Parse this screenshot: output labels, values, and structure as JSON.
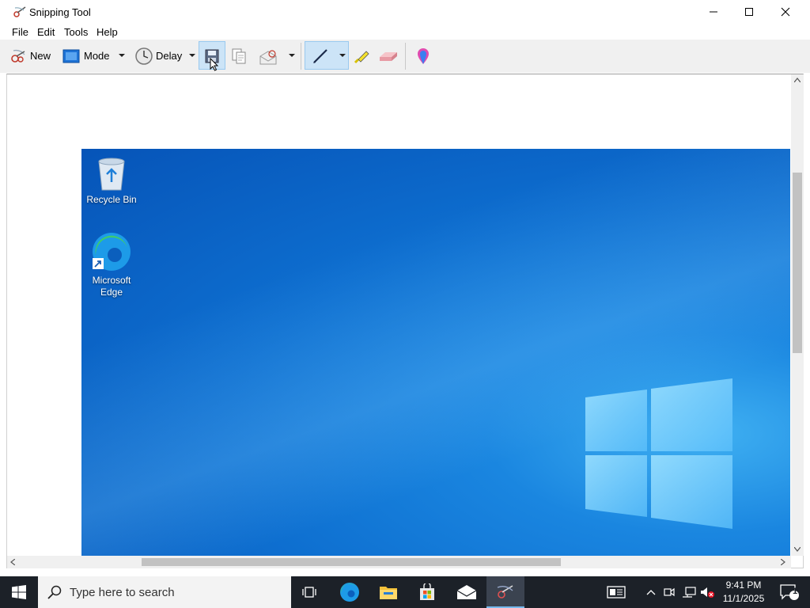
{
  "window": {
    "title": "Snipping Tool",
    "controls": {
      "minimize": "minimize-icon",
      "maximize": "maximize-icon",
      "close": "close-icon"
    }
  },
  "menu": {
    "file": "File",
    "edit": "Edit",
    "tools": "Tools",
    "help": "Help"
  },
  "toolbar": {
    "new_label": "New",
    "mode_label": "Mode",
    "delay_label": "Delay",
    "icons": [
      "new-snip-icon",
      "mode-icon",
      "delay-clock-icon",
      "save-icon",
      "copy-icon",
      "send-email-icon",
      "pen-icon",
      "highlighter-icon",
      "eraser-icon",
      "paint3d-icon"
    ]
  },
  "desktop": {
    "icons": [
      {
        "label": "Recycle Bin"
      },
      {
        "label_line1": "Microsoft",
        "label_line2": "Edge"
      }
    ]
  },
  "taskbar": {
    "search_placeholder": "Type here to search",
    "time": "9:41 PM",
    "date": "11/1/2025",
    "notification_count": "1"
  },
  "colors": {
    "accent": "#0078d7",
    "taskbar": "#1c2128",
    "desktop_blue": "#0e6fd0"
  }
}
